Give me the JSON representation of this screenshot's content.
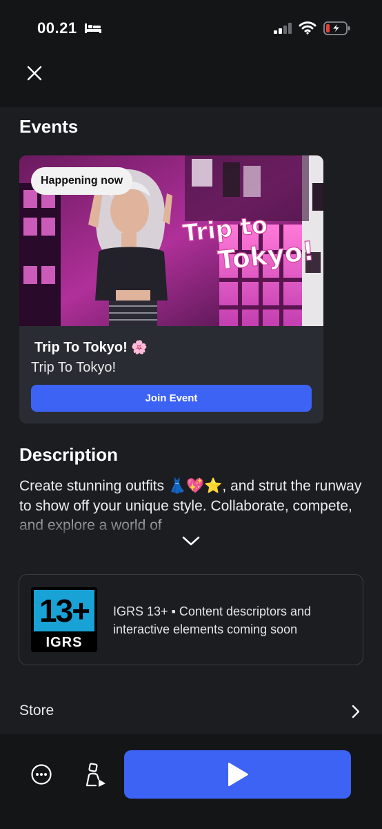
{
  "status_bar": {
    "time": "00.21",
    "icons": [
      "bed-icon",
      "signal-icon",
      "wifi-icon",
      "battery-charging-icon"
    ]
  },
  "header": {
    "close_icon": "close-icon"
  },
  "events": {
    "heading": "Events",
    "card": {
      "badge": "Happening now",
      "banner_logo_text": "Trip to Tokyo!",
      "title": "Trip To Tokyo!",
      "title_emoji": "🌸",
      "subtitle": "Trip To Tokyo!",
      "join_label": "Join Event"
    }
  },
  "description": {
    "heading": "Description",
    "text": "Create stunning outfits 👗💖⭐, and strut the runway to show off your unique style. Collaborate, compete, and explore a world of",
    "expand_icon": "chevron-down-icon"
  },
  "rating": {
    "badge_number": "13+",
    "badge_label": "IGRS",
    "text": "IGRS 13+ ▪ Content descriptors and interactive elements coming soon"
  },
  "store": {
    "label": "Store",
    "chevron_icon": "chevron-right-icon"
  },
  "bottom_bar": {
    "more_icon": "more-icon",
    "avatar_icon": "avatar-play-icon",
    "play_icon": "play-icon"
  },
  "colors": {
    "accent": "#3d63f5",
    "background": "#1c1d21",
    "card": "#2a2c33"
  }
}
